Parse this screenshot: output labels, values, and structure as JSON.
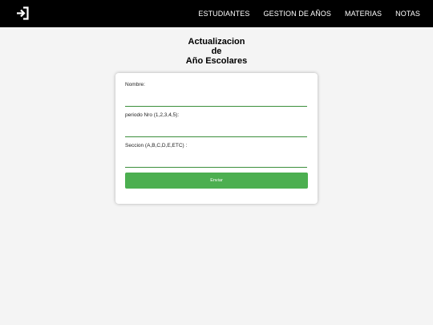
{
  "navbar": {
    "logo_icon": "logout-icon",
    "links": [
      {
        "label": "ESTUDIANTES"
      },
      {
        "label": "GESTION DE AÑOS"
      },
      {
        "label": "MATERIAS"
      },
      {
        "label": "NOTAS"
      }
    ]
  },
  "title": {
    "line1": "Actualizacion",
    "line2": "de",
    "line3": "Año Escolares"
  },
  "form": {
    "fields": [
      {
        "label": "Nombre:",
        "value": ""
      },
      {
        "label": "periodo Nro (1,2,3,4,5):",
        "value": ""
      },
      {
        "label": "Seccion (A,B,C,D,E,ETC) :",
        "value": ""
      }
    ],
    "submit_label": "Enviar"
  },
  "colors": {
    "navbar_bg": "#000000",
    "accent": "#4caf50",
    "input_underline": "#3c8f3c",
    "page_bg": "#f4f4f4"
  }
}
